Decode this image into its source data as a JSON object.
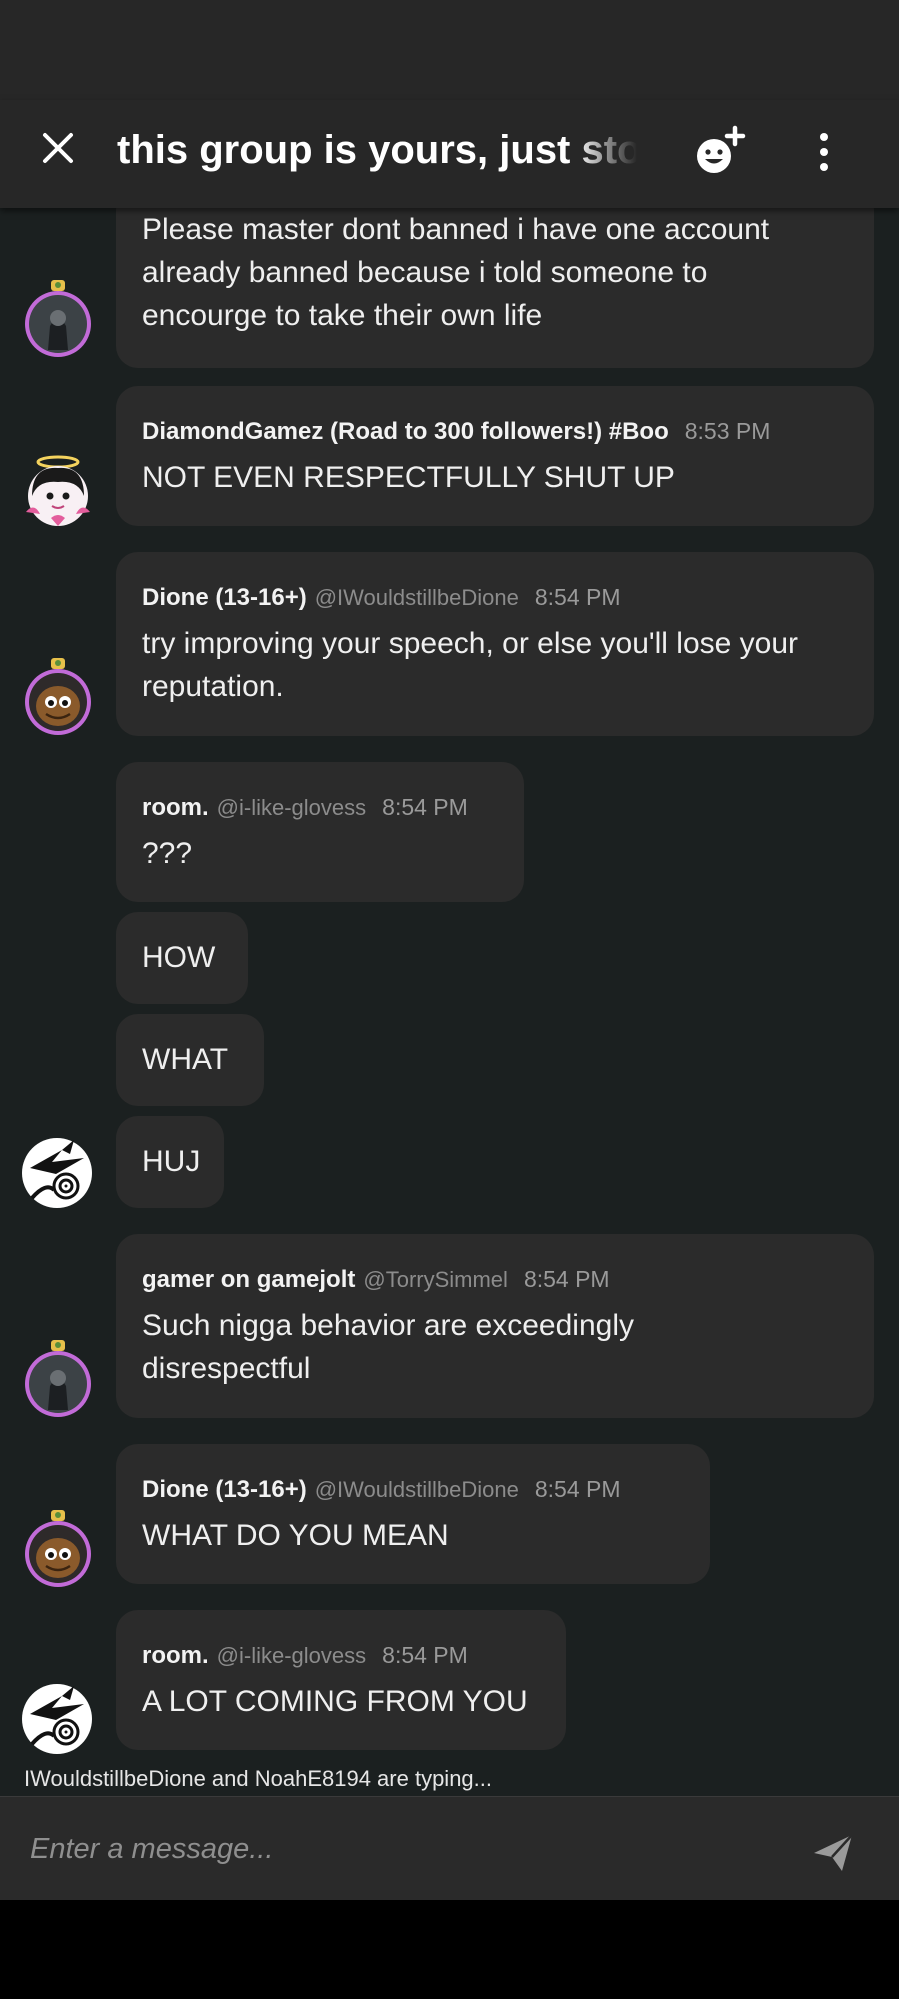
{
  "header": {
    "title": "this group is yours, just stop"
  },
  "chat": {
    "messages": [
      {
        "text": "Please master dont banned i have one account already banned because i told someone to encourge to take their own life"
      },
      {
        "username": "DiamondGamez (Road to 300 followers!) #Boo",
        "time": "8:53 PM",
        "text": "NOT EVEN RESPECTFULLY SHUT UP"
      },
      {
        "username": "Dione (13-16+)",
        "handle": "@IWouldstillbeDione",
        "time": "8:54 PM",
        "text": "try improving your speech, or else you'll lose your reputation."
      },
      {
        "username": "room.",
        "handle": "@i-like-glovess",
        "time": "8:54 PM",
        "text": "???"
      },
      {
        "text": "HOW"
      },
      {
        "text": "WHAT"
      },
      {
        "text": "HUJ"
      },
      {
        "username": "gamer on gamejolt",
        "handle": "@TorrySimmel",
        "time": "8:54 PM",
        "text": "Such nigga behavior are exceedingly disrespectful"
      },
      {
        "username": "Dione (13-16+)",
        "handle": "@IWouldstillbeDione",
        "time": "8:54 PM",
        "text": "WHAT DO YOU MEAN"
      },
      {
        "username": "room.",
        "handle": "@i-like-glovess",
        "time": "8:54 PM",
        "text": "A LOT COMING FROM YOU"
      }
    ],
    "typing_indicator": "IWouldstillbeDione and NoahE8194 are typing..."
  },
  "composer": {
    "placeholder": "Enter a message..."
  },
  "icons": {
    "close": "close-icon",
    "add_member": "add-member-icon",
    "more": "more-vertical-icon",
    "send": "send-icon"
  },
  "colors": {
    "header_bg": "#272727",
    "chat_bg": "#1b2020",
    "bubble_bg": "#2b2b2b",
    "avatar_ring": "#c26bd8"
  }
}
